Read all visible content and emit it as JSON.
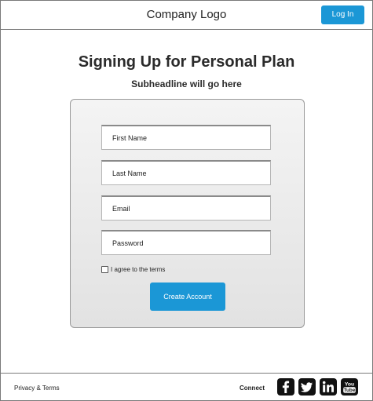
{
  "header": {
    "logo_text": "Company Logo",
    "login_label": "Log In"
  },
  "main": {
    "title": "Signing Up for Personal Plan",
    "subtitle": "Subheadline will go here"
  },
  "form": {
    "first_name_placeholder": "First Name",
    "last_name_placeholder": "Last Name",
    "email_placeholder": "Email",
    "password_placeholder": "Password",
    "agree_label": "I agree to the terms",
    "agree_checked": false,
    "submit_label": "Create Account"
  },
  "footer": {
    "privacy_label": "Privacy & Terms",
    "connect_label": "Connect",
    "social_icons": [
      "facebook-icon",
      "twitter-icon",
      "linkedin-icon",
      "youtube-icon"
    ]
  },
  "colors": {
    "accent": "#1b97d6",
    "border": "#7a7a7a",
    "card_bg": "#e8e8e8"
  }
}
